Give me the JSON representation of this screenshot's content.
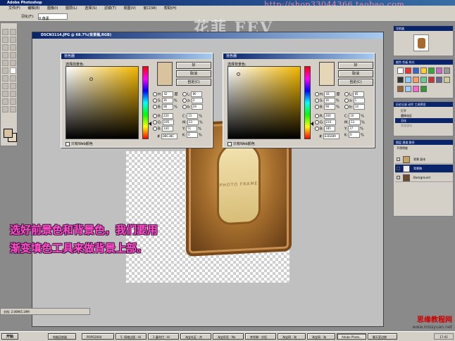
{
  "app": {
    "title": "Adobe Photoshop",
    "menus": [
      "文件(F)",
      "编辑(E)",
      "图像(I)",
      "图层(L)",
      "选择(S)",
      "滤镜(T)",
      "视图(V)",
      "窗口(W)",
      "帮助(H)"
    ],
    "url_overlay": "http://shop33044366.taobao.com",
    "watermark": "花菲 FEV"
  },
  "options_bar": {
    "label": "羽化(F):",
    "value": "0 像素"
  },
  "document": {
    "title": "DSCN3114.JPG @ 68.7%(背景稿,RGB)",
    "frame_text": "PHOTO FRAME"
  },
  "picker_fg": {
    "title": "拾色器",
    "label": "选择前景色:",
    "ok": "好",
    "cancel": "取消",
    "custom": "自定(C)",
    "swatch_color": "#d9c39e",
    "fields": [
      {
        "k": "H",
        "v": "42",
        "u": "度"
      },
      {
        "k": "S",
        "v": "36",
        "u": "%"
      },
      {
        "k": "B",
        "v": "86",
        "u": "%"
      },
      {
        "k": "R",
        "v": "220",
        "u": ""
      },
      {
        "k": "G",
        "v": "195",
        "u": ""
      },
      {
        "k": "B",
        "v": "140",
        "u": ""
      }
    ],
    "fields2": [
      {
        "k": "L",
        "v": "80"
      },
      {
        "k": "a",
        "v": "3"
      },
      {
        "k": "b",
        "v": "29"
      },
      {
        "k": "C",
        "v": "15"
      },
      {
        "k": "M",
        "v": "23"
      },
      {
        "k": "Y",
        "v": "51"
      },
      {
        "k": "K",
        "v": "0"
      }
    ],
    "hex": "DBC38C",
    "web_only": "只有Web颜色"
  },
  "picker_bg": {
    "title": "拾色器",
    "label": "选择背景色:",
    "ok": "好",
    "cancel": "取消",
    "custom": "自定(C)",
    "swatch_color": "#e6d6b8",
    "fields": [
      {
        "k": "H",
        "v": "43",
        "u": "度"
      },
      {
        "k": "S",
        "v": "16",
        "u": "%"
      },
      {
        "k": "B",
        "v": "90",
        "u": "%"
      },
      {
        "k": "R",
        "v": "200",
        "u": ""
      },
      {
        "k": "G",
        "v": "210",
        "u": ""
      },
      {
        "k": "B",
        "v": "185",
        "u": ""
      }
    ],
    "fields2": [
      {
        "k": "L",
        "v": "85"
      },
      {
        "k": "a",
        "v": "1"
      },
      {
        "k": "b",
        "v": "14"
      },
      {
        "k": "C",
        "v": "10"
      },
      {
        "k": "M",
        "v": "13"
      },
      {
        "k": "Y",
        "v": "27"
      },
      {
        "k": "K",
        "v": "0"
      }
    ],
    "hex": "E3D2B9",
    "web_only": "只有Web颜色"
  },
  "navigator": {
    "title": "导航器"
  },
  "styles": {
    "title": "颜色 色板 样式"
  },
  "history": {
    "title": "历史记录 动作 工具预设",
    "items": [
      "打开",
      "魔棒选区",
      "羽化",
      "渐变填充"
    ]
  },
  "layers": {
    "title": "图层 通道 路径",
    "mode": "不透明度",
    "items": [
      "背景 副本",
      "背景稿",
      "Background"
    ]
  },
  "caption": {
    "line1": "选好前景色和背景色，我们要用",
    "line2": "渐变填色工具来做背景上部。"
  },
  "status": {
    "text": "文档: 2.06M/5.19M"
  },
  "taskbar": {
    "start": "开始",
    "items": [
      "电脑回收器",
      "POPO2004",
      "5. 网络出版 - Hi",
      "1.童时代 - Hi",
      "淘宝社区 - 杰",
      "淘宝旺旺 - No",
      "李秀琳 - 对话",
      "淘宝网 - 淘",
      "淘宝网 - 淘",
      "Adobe Photo...",
      "聊天室边桃"
    ],
    "clock": "17:45"
  },
  "site_logo": {
    "name": "思缘教程网",
    "url": "www.missyuan.net"
  }
}
